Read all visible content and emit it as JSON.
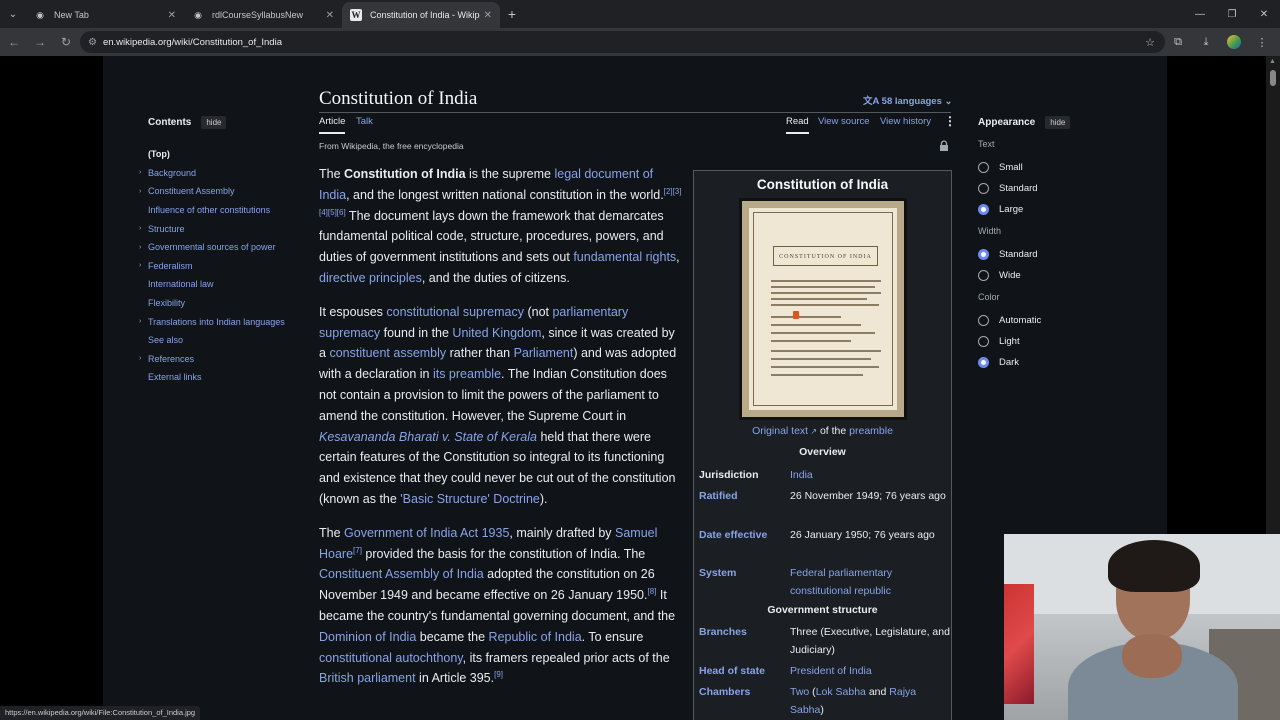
{
  "browser": {
    "tabs": [
      {
        "title": "New Tab",
        "active": false
      },
      {
        "title": "rdlCourseSyllabusNew",
        "active": false
      },
      {
        "title": "Constitution of India - Wikipedi",
        "active": true
      }
    ],
    "url": "en.wikipedia.org/wiki/Constitution_of_India",
    "status_url": "https://en.wikipedia.org/wiki/File:Constitution_of_India.jpg"
  },
  "article": {
    "title": "Constitution of India",
    "languages": "58 languages",
    "tab_article": "Article",
    "tab_talk": "Talk",
    "tab_read": "Read",
    "tab_view_source": "View source",
    "tab_view_history": "View history",
    "from_wiki": "From Wikipedia, the free encyclopedia"
  },
  "toc": {
    "title": "Contents",
    "hide": "hide",
    "items": [
      {
        "label": "(Top)",
        "expandable": false
      },
      {
        "label": "Background",
        "expandable": true
      },
      {
        "label": "Constituent Assembly",
        "expandable": true
      },
      {
        "label": "Influence of other constitutions",
        "expandable": false
      },
      {
        "label": "Structure",
        "expandable": true
      },
      {
        "label": "Governmental sources of power",
        "expandable": true
      },
      {
        "label": "Federalism",
        "expandable": true
      },
      {
        "label": "International law",
        "expandable": false
      },
      {
        "label": "Flexibility",
        "expandable": false
      },
      {
        "label": "Translations into Indian languages",
        "expandable": true
      },
      {
        "label": "See also",
        "expandable": false
      },
      {
        "label": "References",
        "expandable": true
      },
      {
        "label": "External links",
        "expandable": false
      }
    ]
  },
  "body": {
    "p1": {
      "t1": "The ",
      "bold": "Constitution of India",
      "t2": " is the supreme ",
      "l1": "legal document of India",
      "t3": ", and the longest written national constitution in the world.",
      "refs1": "[2][3][4][5][6]",
      "t4": " The document lays down the framework that demarcates fundamental political code, structure, procedures, powers, and duties of government institutions and sets out ",
      "l2": "fundamental rights",
      "t5": ", ",
      "l3": "directive principles",
      "t6": ", and the duties of citizens."
    },
    "p2": {
      "t1": "It espouses ",
      "l1": "constitutional supremacy",
      "t2": " (not ",
      "l2": "parliamentary supremacy",
      "t3": " found in the ",
      "l3": "United Kingdom",
      "t4": ", since it was created by a ",
      "l4": "constituent assembly",
      "t5": " rather than ",
      "l5": "Parliament",
      "t6": ") and was adopted with a declaration in ",
      "l6": "its preamble",
      "t7": ". The Indian Constitution does not contain a provision to limit the powers of the parliament to amend the constitution. However, the Supreme Court in ",
      "l7": "Kesavananda Bharati v. State of Kerala",
      "t8": " held that there were certain features of the Constitution so integral to its functioning and existence that they could never be cut out of the constitution (known as the ",
      "l8": "'Basic Structure' Doctrine",
      "t9": ")."
    },
    "p3": {
      "t1": "The ",
      "l1": "Government of India Act 1935",
      "t2": ", mainly drafted by ",
      "l2": "Samuel Hoare",
      "ref1": "[7]",
      "t3": " provided the basis for the constitution of India. The ",
      "l3": "Constituent Assembly of India",
      "t4": " adopted the constitution on 26 November 1949 and became effective on 26 January 1950.",
      "ref2": "[8]",
      "t5": " It became the country's fundamental governing document, and the ",
      "l4": "Dominion of India",
      "t6": " became the ",
      "l5": "Republic of India",
      "t7": ". To ensure ",
      "l6": "constitutional autochthony",
      "t8": ", its framers repealed prior acts of the ",
      "l7": "British parliament",
      "t9": " in Article 395.",
      "ref3": "[9]"
    }
  },
  "infobox": {
    "title": "Constitution of India",
    "image_heading": "CONSTITUTION OF INDIA",
    "caption_link1": "Original text",
    "caption_mid": " of the ",
    "caption_link2": "preamble",
    "overview": "Overview",
    "jurisdiction_label": "Jurisdiction",
    "jurisdiction_value": "India",
    "ratified_label": "Ratified",
    "ratified_value": "26 November 1949; 76 years ago",
    "effective_label": "Date effective",
    "effective_value": "26 January 1950; 76 years ago",
    "system_label": "System",
    "system_value": "Federal parliamentary constitutional republic",
    "gov_structure": "Government structure",
    "branches_label": "Branches",
    "branches_value": "Three (Executive, Legislature, and Judiciary)",
    "head_label": "Head of state",
    "head_value": "President of India",
    "chambers_label": "Chambers",
    "chambers_v1": "Two",
    "chambers_v2": " (",
    "chambers_v3": "Lok Sabha",
    "chambers_v4": " and ",
    "chambers_v5": "Rajya Sabha",
    "chambers_v6": ")"
  },
  "appearance": {
    "title": "Appearance",
    "hide": "hide",
    "text_label": "Text",
    "text_options": [
      "Small",
      "Standard",
      "Large"
    ],
    "text_selected": "Large",
    "width_label": "Width",
    "width_options": [
      "Standard",
      "Wide"
    ],
    "width_selected": "Standard",
    "color_label": "Color",
    "color_options": [
      "Automatic",
      "Light",
      "Dark"
    ],
    "color_selected": "Dark"
  }
}
